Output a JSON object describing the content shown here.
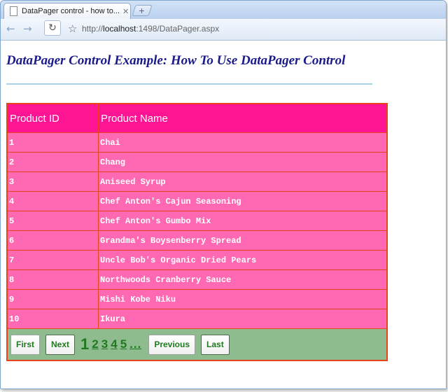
{
  "browser": {
    "tab_title": "DataPager control - how to...",
    "tab_close": "✕",
    "new_tab": "+",
    "url_prefix": "http://",
    "url_host": "localhost",
    "url_rest": ":1498/DataPager.aspx"
  },
  "page": {
    "heading": "DataPager Control Example: How To Use DataPager Control"
  },
  "grid": {
    "columns": [
      "Product ID",
      "Product Name"
    ],
    "rows": [
      {
        "id": "1",
        "name": "Chai"
      },
      {
        "id": "2",
        "name": "Chang"
      },
      {
        "id": "3",
        "name": "Aniseed Syrup"
      },
      {
        "id": "4",
        "name": "Chef Anton's Cajun Seasoning"
      },
      {
        "id": "5",
        "name": "Chef Anton's Gumbo Mix"
      },
      {
        "id": "6",
        "name": "Grandma's Boysenberry Spread"
      },
      {
        "id": "7",
        "name": "Uncle Bob's Organic Dried Pears"
      },
      {
        "id": "8",
        "name": "Northwoods Cranberry Sauce"
      },
      {
        "id": "9",
        "name": "Mishi Kobe Niku"
      },
      {
        "id": "10",
        "name": "Ikura"
      }
    ]
  },
  "pager": {
    "first": "First",
    "next": "Next",
    "current": "1",
    "pages": [
      "2",
      "3",
      "4",
      "5"
    ],
    "more": "...",
    "previous": "Previous",
    "last": "Last"
  },
  "colors": {
    "header": "#ff1493",
    "row": "#ff69b4",
    "border": "#e8431a",
    "pager": "#8fbc8f",
    "heading": "#1a1a8c"
  }
}
